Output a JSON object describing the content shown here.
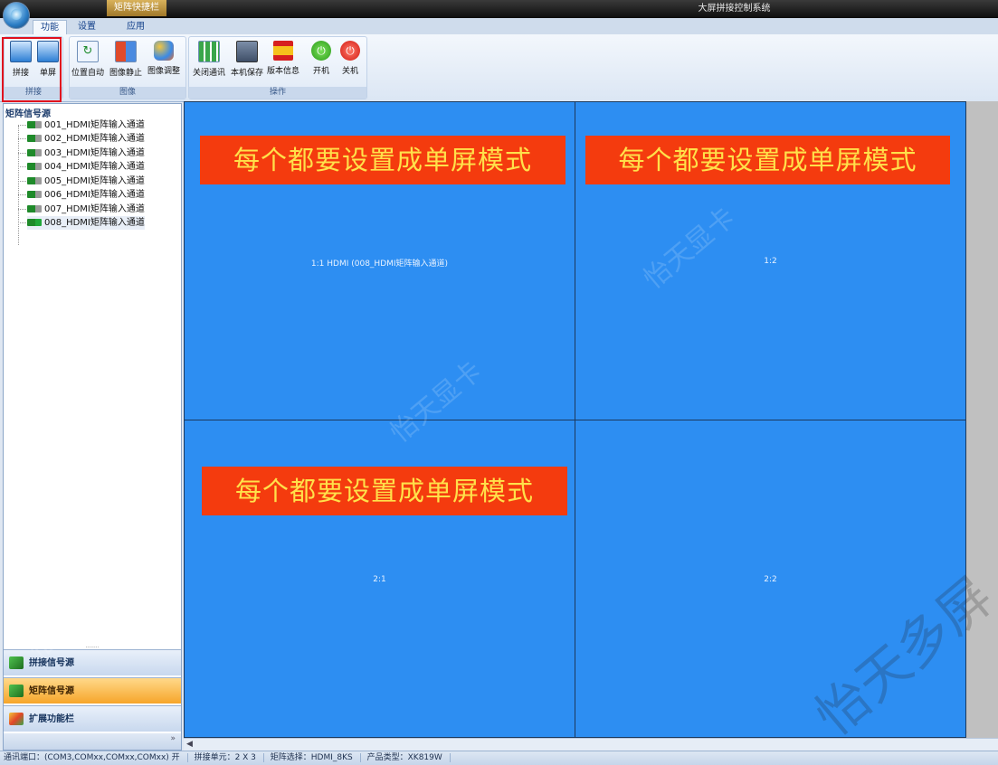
{
  "window": {
    "title": "大屏拼接控制系统",
    "quick_access_label": "矩阵快捷栏"
  },
  "tabs": [
    {
      "label": "功能"
    },
    {
      "label": "设置"
    },
    {
      "label": "应用"
    }
  ],
  "ribbon": {
    "groups": [
      {
        "label": "拼接",
        "buttons": [
          {
            "label": "拼接"
          },
          {
            "label": "单屏"
          }
        ]
      },
      {
        "label": "图像",
        "buttons": [
          {
            "label": "位置自动"
          },
          {
            "label": "图像静止"
          },
          {
            "label": "图像调整"
          }
        ]
      },
      {
        "label": "操作",
        "buttons": [
          {
            "label": "关闭通讯"
          },
          {
            "label": "本机保存"
          },
          {
            "label": "版本信息"
          },
          {
            "label": "开机"
          },
          {
            "label": "关机"
          }
        ]
      }
    ]
  },
  "tree": {
    "header": "矩阵信号源",
    "items": [
      {
        "label": "001_HDMI矩阵输入通道"
      },
      {
        "label": "002_HDMI矩阵输入通道"
      },
      {
        "label": "003_HDMI矩阵输入通道"
      },
      {
        "label": "004_HDMI矩阵输入通道"
      },
      {
        "label": "005_HDMI矩阵输入通道"
      },
      {
        "label": "006_HDMI矩阵输入通道"
      },
      {
        "label": "007_HDMI矩阵输入通道"
      },
      {
        "label": "008_HDMI矩阵输入通道"
      }
    ]
  },
  "nav": {
    "items": [
      {
        "label": "拼接信号源"
      },
      {
        "label": "矩阵信号源"
      },
      {
        "label": "扩展功能栏"
      }
    ],
    "collapse": "»",
    "splitter": "........"
  },
  "screen": {
    "cells": [
      {
        "label": "1:1 HDMI (008_HDMI矩阵输入通道)"
      },
      {
        "label": "1:2"
      },
      {
        "label": "2:1"
      },
      {
        "label": "2:2"
      }
    ],
    "banner_text": "每个都要设置成单屏模式"
  },
  "status": {
    "port": "通讯端口：(COM3,COMxx,COMxx,COMxx) 开",
    "unit": "拼接单元：2 X 3",
    "matrix": "矩阵选择：HDMI_8KS",
    "product": "产品类型：XK819W"
  },
  "watermark": {
    "small": "怡天显卡",
    "big": "怡天多屏"
  },
  "colors": {
    "cell_blue": "#2d8ef2",
    "banner_red": "#f43b0e",
    "banner_text": "#ffe14a",
    "highlight": "#e0101e"
  }
}
